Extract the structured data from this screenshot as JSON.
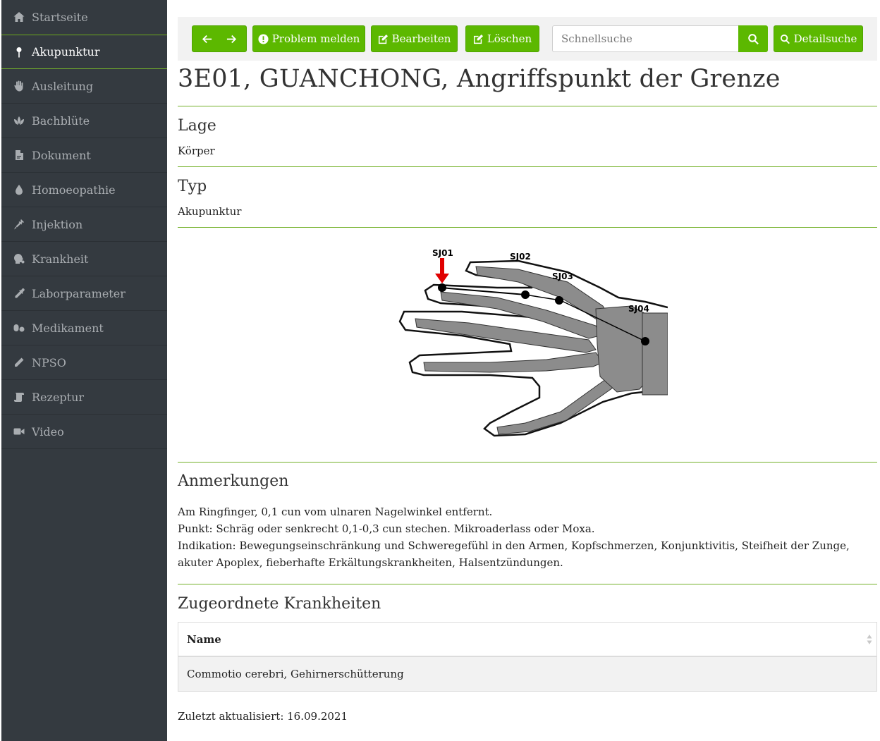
{
  "sidebar": {
    "items": [
      {
        "label": "Startseite",
        "icon": "home-icon"
      },
      {
        "label": "Akupunktur",
        "icon": "pin-icon",
        "active": true
      },
      {
        "label": "Ausleitung",
        "icon": "hand-icon"
      },
      {
        "label": "Bachblüte",
        "icon": "lotus-icon"
      },
      {
        "label": "Dokument",
        "icon": "pdf-file-icon"
      },
      {
        "label": "Homoeopathie",
        "icon": "drop-icon"
      },
      {
        "label": "Injektion",
        "icon": "syringe-icon"
      },
      {
        "label": "Krankheit",
        "icon": "head-virus-icon"
      },
      {
        "label": "Laborparameter",
        "icon": "eyedropper-icon"
      },
      {
        "label": "Medikament",
        "icon": "pills-icon"
      },
      {
        "label": "NPSO",
        "icon": "pencil-icon"
      },
      {
        "label": "Rezeptur",
        "icon": "scroll-icon"
      },
      {
        "label": "Video",
        "icon": "video-icon"
      }
    ]
  },
  "toolbar": {
    "report_label": "Problem melden",
    "edit_label": "Bearbeiten",
    "delete_label": "Löschen",
    "search_placeholder": "Schnellsuche",
    "detail_search_label": "Detailsuche"
  },
  "page": {
    "title": "3E01, GUANCHONG, Angriffspunkt der Grenze",
    "location_heading": "Lage",
    "location_value": "Körper",
    "type_heading": "Typ",
    "type_value": "Akupunktur",
    "image_labels": [
      "SJ01",
      "SJ02",
      "SJ03",
      "SJ04"
    ],
    "notes_heading": "Anmerkungen",
    "notes": [
      "Am Ringfinger, 0,1 cun vom ulnaren Nagelwinkel entfernt.",
      "Punkt: Schräg oder senkrecht 0,1-0,3 cun stechen. Mikroaderlass oder Moxa.",
      "Indikation: Bewegungseinschränkung und Schweregefühl in den Armen, Kopfschmerzen, Konjunktivitis, Steifheit der Zunge, akuter Apoplex, fieberhafte Erkältungskrankheiten, Halsentzündungen."
    ],
    "related_heading": "Zugeordnete Krankheiten",
    "table_header": "Name",
    "table_rows": [
      "Commotio cerebri, Gehirnerschütterung"
    ],
    "updated": "Zuletzt aktualisiert: 16.09.2021"
  },
  "colors": {
    "sidebar_bg": "#343a40",
    "accent_green": "#5cb800",
    "divider_green": "#74b12a"
  }
}
